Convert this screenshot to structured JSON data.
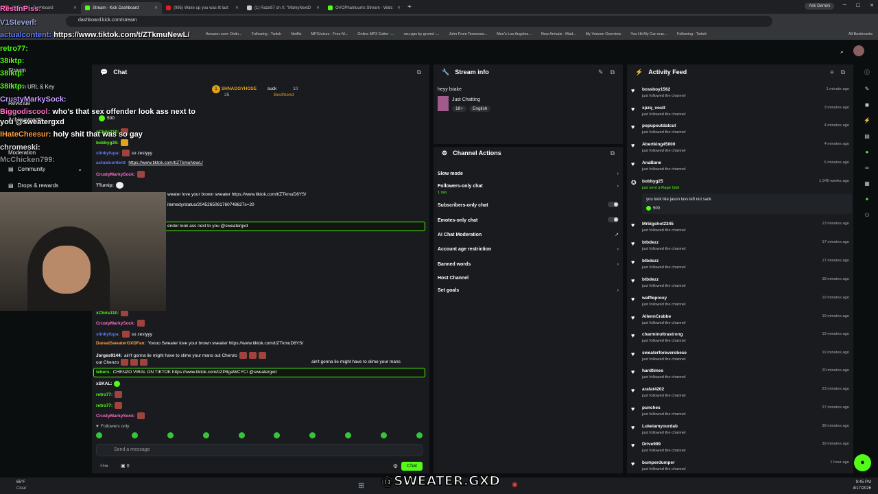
{
  "browser": {
    "tabs": [
      {
        "label": "(8) Toolkit - Dashboard",
        "color": "#e84141"
      },
      {
        "label": "Stream - Kick Dashboard",
        "color": "#53fc18"
      },
      {
        "label": "(995) Wake up you was lit last",
        "color": "#e02020"
      },
      {
        "label": "(1) Razo97 on X: \"MarkyNextD",
        "color": "#cccccc"
      },
      {
        "label": "OVOPhantuums Stream - Watc",
        "color": "#53fc18"
      }
    ],
    "ask_label": "Ask Gemini",
    "url": "dashboard.kick.com/stream",
    "bookmarks": [
      "Amazon.com: Onlin...",
      "Following - Twitch",
      "Netflix",
      "MP3Juices - Free M...",
      "Online MP3 Cutter -...",
      "osu-pps by grumd -...",
      "John From Tennesse...",
      "Men's Los Angeles...",
      "New Arrivals - Mad...",
      "My Verizon Overview",
      "You Hit My Car reac...",
      "Following - Twitch"
    ],
    "all_bookmarks": "All Bookmarks"
  },
  "sidebar": {
    "items": [
      "Stream",
      "Stream URL & Key",
      "Revenue",
      "Achievements",
      "Moderation",
      "Community",
      "Drops & rewards"
    ]
  },
  "overlay_chat": [
    {
      "user": "RestInPiss:",
      "text": ""
    },
    {
      "user": "V1Steven:",
      "text": ""
    },
    {
      "user": "actualcontent:",
      "text": "https://www.tiktok.com/t/ZTkmuNewL/"
    },
    {
      "user": "retro77:",
      "text": ""
    },
    {
      "user": "38iktp:",
      "text": ""
    },
    {
      "user": "38iktp:",
      "text": ""
    },
    {
      "user": "38iktp:",
      "text": ""
    },
    {
      "user": "CrustyMarkySock:",
      "text": ""
    },
    {
      "user": "Biggodiscool:",
      "text": "who's that sex offender look ass next to"
    },
    {
      "user": "",
      "text": "you @sweatergxd"
    },
    {
      "user": "IHateCheesur:",
      "text": "holy shit that was so gay"
    },
    {
      "user": "chromeski:",
      "text": ""
    },
    {
      "user": "McChicken799:",
      "text": ""
    }
  ],
  "chat": {
    "title": "Chat",
    "pinned_user": "SHNAGGYHOSE",
    "pinned_count": "25",
    "pinned_text": "suck",
    "pinned_num": "10",
    "pinned_badge": "Bestfriend",
    "kicks": "500",
    "messages": [
      {
        "user": "xChris310:",
        "text": "",
        "color": "#53fc18"
      },
      {
        "user": "bobbyg25:",
        "text": "",
        "color": "#53fc18"
      },
      {
        "user": "stinkyfupa:",
        "text": "so zestyyy",
        "color": "#5f7cff"
      },
      {
        "user": "actualcontent:",
        "text": "https://www.tiktok.com/t/ZTkmuNewL/",
        "color": "#5f7cff"
      },
      {
        "user": "CrustyMarkySock:",
        "text": "",
        "color": "#ff6ec7"
      },
      {
        "user": "TTurnip:",
        "text": "",
        "color": "#ddd"
      },
      {
        "user": "",
        "text": "weater love your brown sweater https://www.tiktok.com/t/ZTkmuD6YS/",
        "color": "#fff"
      },
      {
        "user": "",
        "text": "itemedy/status/2045265061760748627s=20",
        "color": "#fff"
      },
      {
        "user": "",
        "text": "ender look ass next to you @sweatergxd",
        "color": "#fff"
      },
      {
        "user": "xChris310:",
        "text": "",
        "color": "#53fc18"
      },
      {
        "user": "CrustyMarkySock:",
        "text": "",
        "color": "#ff6ec7"
      },
      {
        "user": "stinkyfupa:",
        "text": "so zestyyy",
        "color": "#5f7cff"
      },
      {
        "user": "DarealSweaterGXDFan:",
        "text": "Yoooo Sweater love your brown sweater https://www.tiktok.com/t/ZTkmuD6YS/",
        "color": "#ff9f43"
      },
      {
        "user": "Jorges9144:",
        "text": "ain't gonna lie might have to slime your mans out Chenzo",
        "color": "#fff"
      },
      {
        "user": "",
        "text": "ain't gonna lie might have to slime your mans",
        "color": "#fff"
      },
      {
        "user": "",
        "text": "out Chenzo",
        "color": "#fff"
      },
      {
        "user": "tebers:",
        "text": "CHENZO VIRAL ON TIKTOK https://www.tiktok.com/t/ZP8gaWCYC/ @sweatergxd",
        "color": "#53fc18"
      },
      {
        "user": "xSKAL:",
        "text": "",
        "color": "#fff"
      },
      {
        "user": "retro77:",
        "text": "",
        "color": "#53fc18"
      },
      {
        "user": "retro77:",
        "text": "",
        "color": "#53fc18"
      },
      {
        "user": "CrustyMarkySock:",
        "text": "",
        "color": "#ff6ec7"
      }
    ],
    "followers_only": "Followers only",
    "input_placeholder": "Send a message",
    "count": "0",
    "send_label": "Chat"
  },
  "stream_info": {
    "title": "Stream info",
    "stream_title": "heyy lstake",
    "category": "Just Chatting",
    "tags": [
      "18+",
      "English"
    ]
  },
  "channel_actions": {
    "title": "Channel Actions",
    "items": [
      {
        "label": "Slow mode",
        "sub": ""
      },
      {
        "label": "Followers-only chat",
        "sub": "1 min"
      },
      {
        "label": "Subscribers-only chat",
        "sub": ""
      },
      {
        "label": "Emotes-only chat",
        "sub": ""
      },
      {
        "label": "AI Chat Moderation",
        "sub": ""
      },
      {
        "label": "Account age restriction",
        "sub": ""
      },
      {
        "label": "Banned words",
        "sub": ""
      },
      {
        "label": "Host Channel",
        "sub": ""
      },
      {
        "label": "Set goals",
        "sub": ""
      }
    ]
  },
  "activity": {
    "title": "Activity Feed",
    "items": [
      {
        "name": "bossboy1562",
        "sub": "just followed the channel",
        "time": "1 minute ago"
      },
      {
        "name": "xpzq_voult",
        "sub": "just followed the channel",
        "time": "3 minutes ago"
      },
      {
        "name": "popupoutdatcut",
        "sub": "just followed the channel",
        "time": "4 minutes ago"
      },
      {
        "name": "Abertking45000",
        "sub": "just followed the channel",
        "time": "4 minutes ago"
      },
      {
        "name": "AnaBane",
        "sub": "just followed the channel",
        "time": "6 minutes ago"
      },
      {
        "name": "bobbyg25",
        "sub": "just sent a Rage Quit",
        "time": "1,945 weeks ago"
      },
      {
        "name": "Mrbigshot2345",
        "sub": "just followed the channel",
        "time": "13 minutes ago"
      },
      {
        "name": "btbdezz",
        "sub": "just followed the channel",
        "time": "17 minutes ago"
      },
      {
        "name": "btbdezz",
        "sub": "just followed the channel",
        "time": "17 minutes ago"
      },
      {
        "name": "btbdezz",
        "sub": "just followed the channel",
        "time": "18 minutes ago"
      },
      {
        "name": "waffleproxy",
        "sub": "just followed the channel",
        "time": "19 minutes ago"
      },
      {
        "name": "AllennCrabbe",
        "sub": "just followed the channel",
        "time": "19 minutes ago"
      },
      {
        "name": "charminultrastrong",
        "sub": "just followed the channel",
        "time": "19 minutes ago"
      },
      {
        "name": "sweaterforeverobese",
        "sub": "just followed the channel",
        "time": "19 minutes ago"
      },
      {
        "name": "hardtimes",
        "sub": "just followed the channel",
        "time": "20 minutes ago"
      },
      {
        "name": "arafat4202",
        "sub": "just followed the channel",
        "time": "23 minutes ago"
      },
      {
        "name": "punches",
        "sub": "just followed the channel",
        "time": "27 minutes ago"
      },
      {
        "name": "Lukeiamyourdab",
        "sub": "just followed the channel",
        "time": "38 minutes ago"
      },
      {
        "name": "Drive999",
        "sub": "just followed the channel",
        "time": "39 minutes ago"
      },
      {
        "name": "bumperdumper",
        "sub": "just followed the channel",
        "time": "1 hour ago"
      }
    ],
    "rage_message": "you look like jason luvs left nut sack",
    "rage_amount": "500"
  },
  "taskbar": {
    "weather_temp": "65°F",
    "weather_label": "Clear",
    "time": "9:45 PM",
    "date": "4/17/2026"
  },
  "watermark": "@SWEATER.GXD",
  "colors": {
    "accent": "#53fc18",
    "panel": "#191b1f",
    "bg": "#0b0e0f"
  }
}
